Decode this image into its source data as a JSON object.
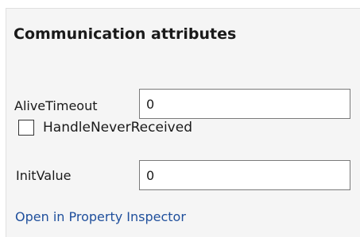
{
  "section": {
    "title": "Communication attributes"
  },
  "fields": {
    "alive_timeout": {
      "label": "AliveTimeout",
      "value": "0"
    },
    "handle_never_received": {
      "label": "HandleNeverReceived",
      "checked": false
    },
    "init_value": {
      "label": "InitValue",
      "value": "0"
    }
  },
  "link": {
    "label": "Open in Property Inspector",
    "color": "#1f4f9c"
  }
}
